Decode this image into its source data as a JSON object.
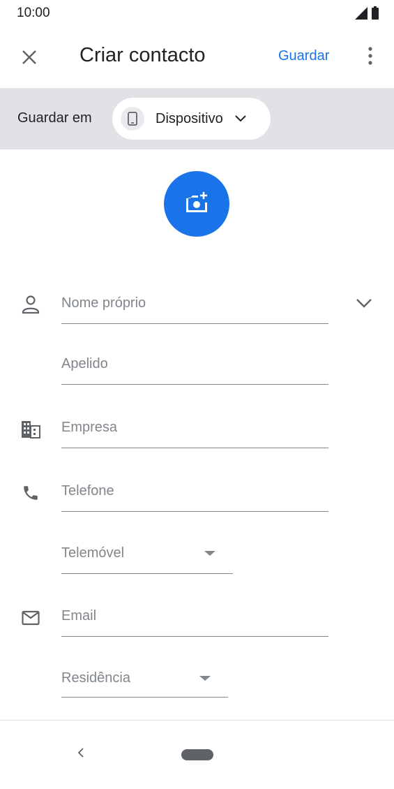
{
  "status_bar": {
    "time": "10:00",
    "icons": [
      "signal-icon",
      "battery-icon"
    ]
  },
  "app_bar": {
    "close_icon": "close-icon",
    "title": "Criar contacto",
    "save_label": "Guardar",
    "more_icon": "more-vert-icon"
  },
  "save_location": {
    "label": "Guardar em",
    "account": "Dispositivo",
    "account_icon": "phone-device-icon"
  },
  "photo": {
    "icon": "add-photo-icon",
    "color": "#1a73e8"
  },
  "form": {
    "name": {
      "icon": "person-icon",
      "placeholder": "Nome próprio"
    },
    "surname": {
      "placeholder": "Apelido"
    },
    "company": {
      "icon": "business-icon",
      "placeholder": "Empresa"
    },
    "phone": {
      "icon": "phone-icon",
      "placeholder": "Telefone",
      "type": "Telemóvel"
    },
    "email": {
      "icon": "mail-icon",
      "placeholder": "Email",
      "type": "Residência"
    }
  },
  "nav": {
    "back_icon": "back-icon",
    "home_icon": "home-pill-icon"
  },
  "colors": {
    "accent": "#1a73e8",
    "save_bar_bg": "#e1e2e6",
    "placeholder": "#80868b"
  }
}
